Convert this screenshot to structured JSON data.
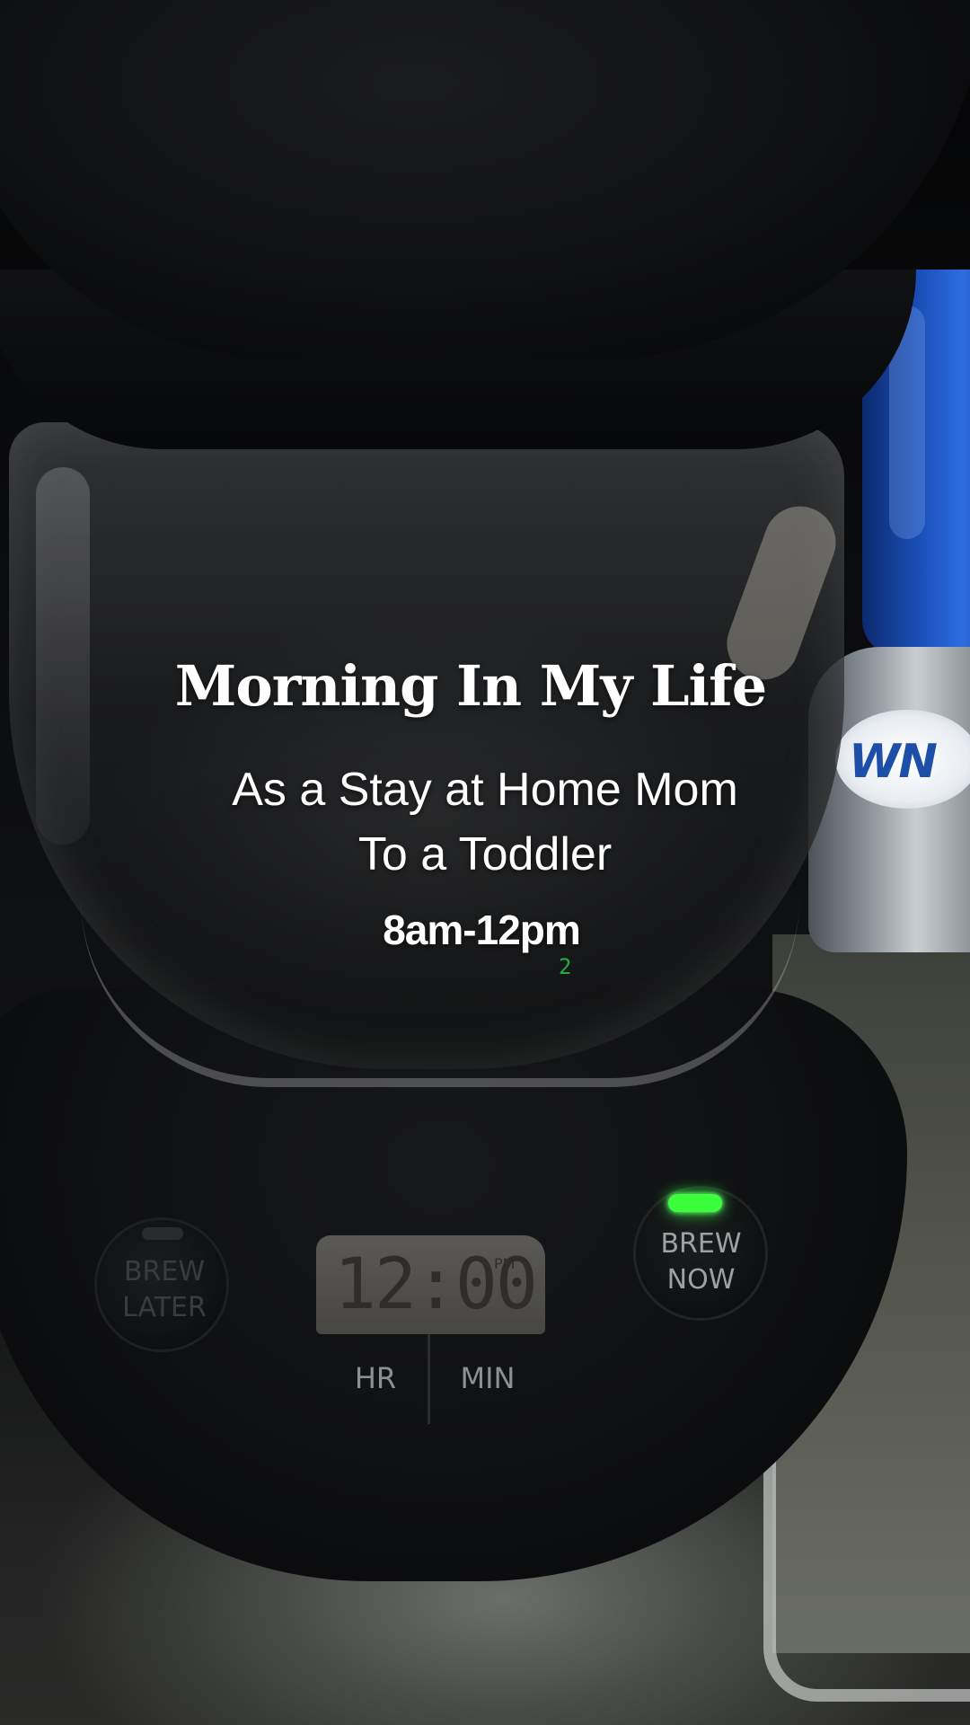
{
  "overlay": {
    "title": "Morning In My Life",
    "subtitle": "As a Stay at Home Mom\nTo a Toddler",
    "time_range": "8am-12pm"
  },
  "coffee_maker": {
    "brew_later_label": "BREW\nLATER",
    "brew_now_label": "BREW\nNOW",
    "clock_time": "12:00",
    "clock_ampm": "PM",
    "hr_label": "HR",
    "min_label": "MIN",
    "brew_now_led_color": "#3cff3c",
    "reflection_digit": "2"
  },
  "background": {
    "bottle_label": "WN",
    "bottle_color": "#1a4fb8"
  }
}
